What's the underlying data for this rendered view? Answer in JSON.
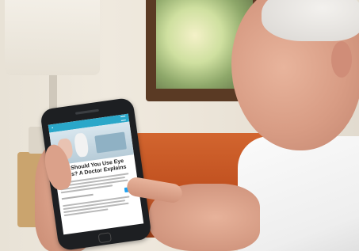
{
  "scene": {
    "phone_screen": {
      "article_title": "How Should You Use Eye Drops? A Doctor Explains"
    }
  },
  "colors": {
    "app_header": "#2aa7c9",
    "sofa": "#c95a27",
    "shirt": "#f2f2f2",
    "window_frame": "#5a3a24"
  },
  "icons": [
    "menu-icon",
    "twitter-icon",
    "facebook-icon",
    "home-button-icon"
  ]
}
